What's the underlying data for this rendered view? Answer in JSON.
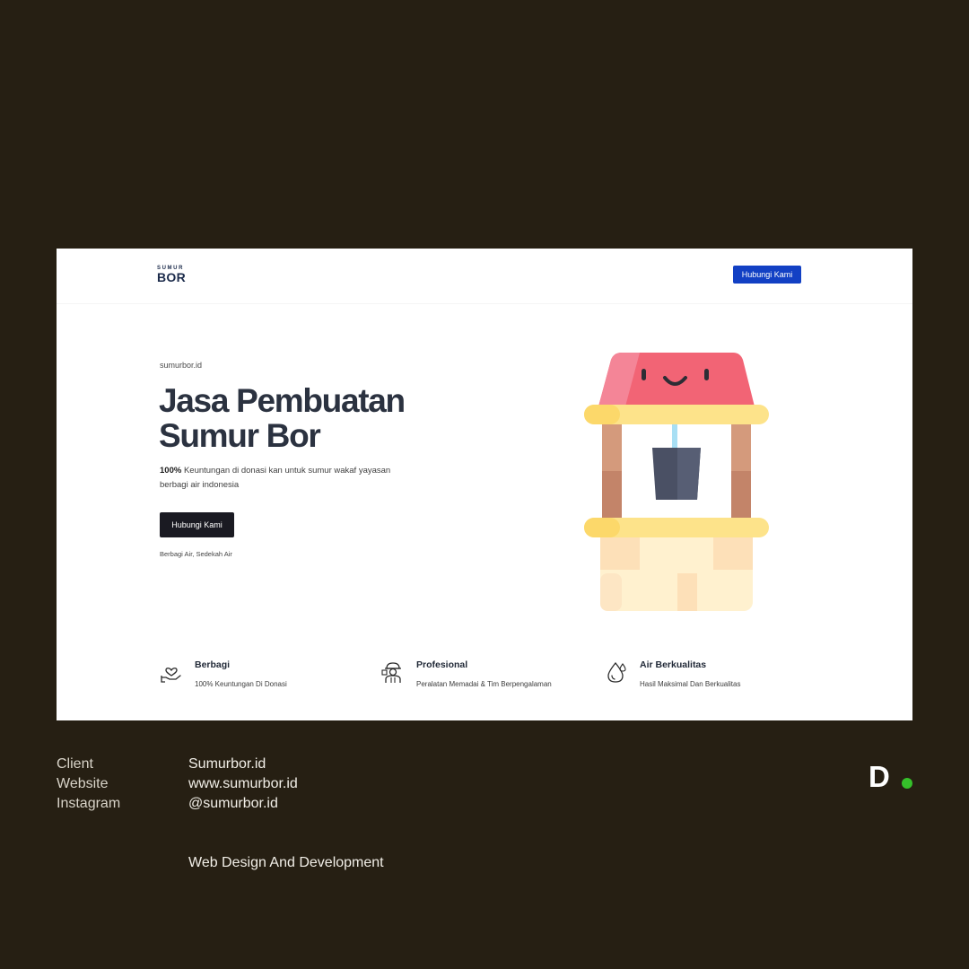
{
  "nav": {
    "logo_top": "SUMUR",
    "logo_main": "BOR",
    "cta_label": "Hubungi Kami",
    "cta_color": "#1240c4"
  },
  "hero": {
    "eyebrow": "sumurbor.id",
    "title_line1": "Jasa Pembuatan",
    "title_line2": "Sumur Bor",
    "desc_bold": "100%",
    "desc_line1": " Keuntungan di donasi kan untuk sumur wakaf yayasan",
    "desc_line2": "berbagi air indonesia",
    "cta_label": "Hubungi Kami",
    "tagline": "Berbagi Air, Sedekah Air",
    "illustration_icon": "water-well-icon"
  },
  "features": [
    {
      "icon": "heart-hand-icon",
      "title": "Berbagi",
      "desc": "100% Keuntungan Di Donasi"
    },
    {
      "icon": "worker-icon",
      "title": "Profesional",
      "desc": "Peralatan Memadai & Tim Berpengalaman"
    },
    {
      "icon": "water-drop-icon",
      "title": "Air Berkualitas",
      "desc": "Hasil Maksimal Dan Berkualitas"
    }
  ],
  "info": {
    "client_label": "Client",
    "client_value": "Sumurbor.id",
    "website_label": "Website",
    "website_value": "www.sumurbor.id",
    "instagram_label": "Instagram",
    "instagram_value": "@sumurbor.id",
    "service": "Web Design And Development"
  },
  "brand": {
    "letter": "D",
    "dot_color": "#35c02a"
  },
  "colors": {
    "background": "#261f13",
    "roof": "#f26475",
    "beam": "#fde38a",
    "post": "#d49a7c",
    "bucket": "#4a5064"
  }
}
